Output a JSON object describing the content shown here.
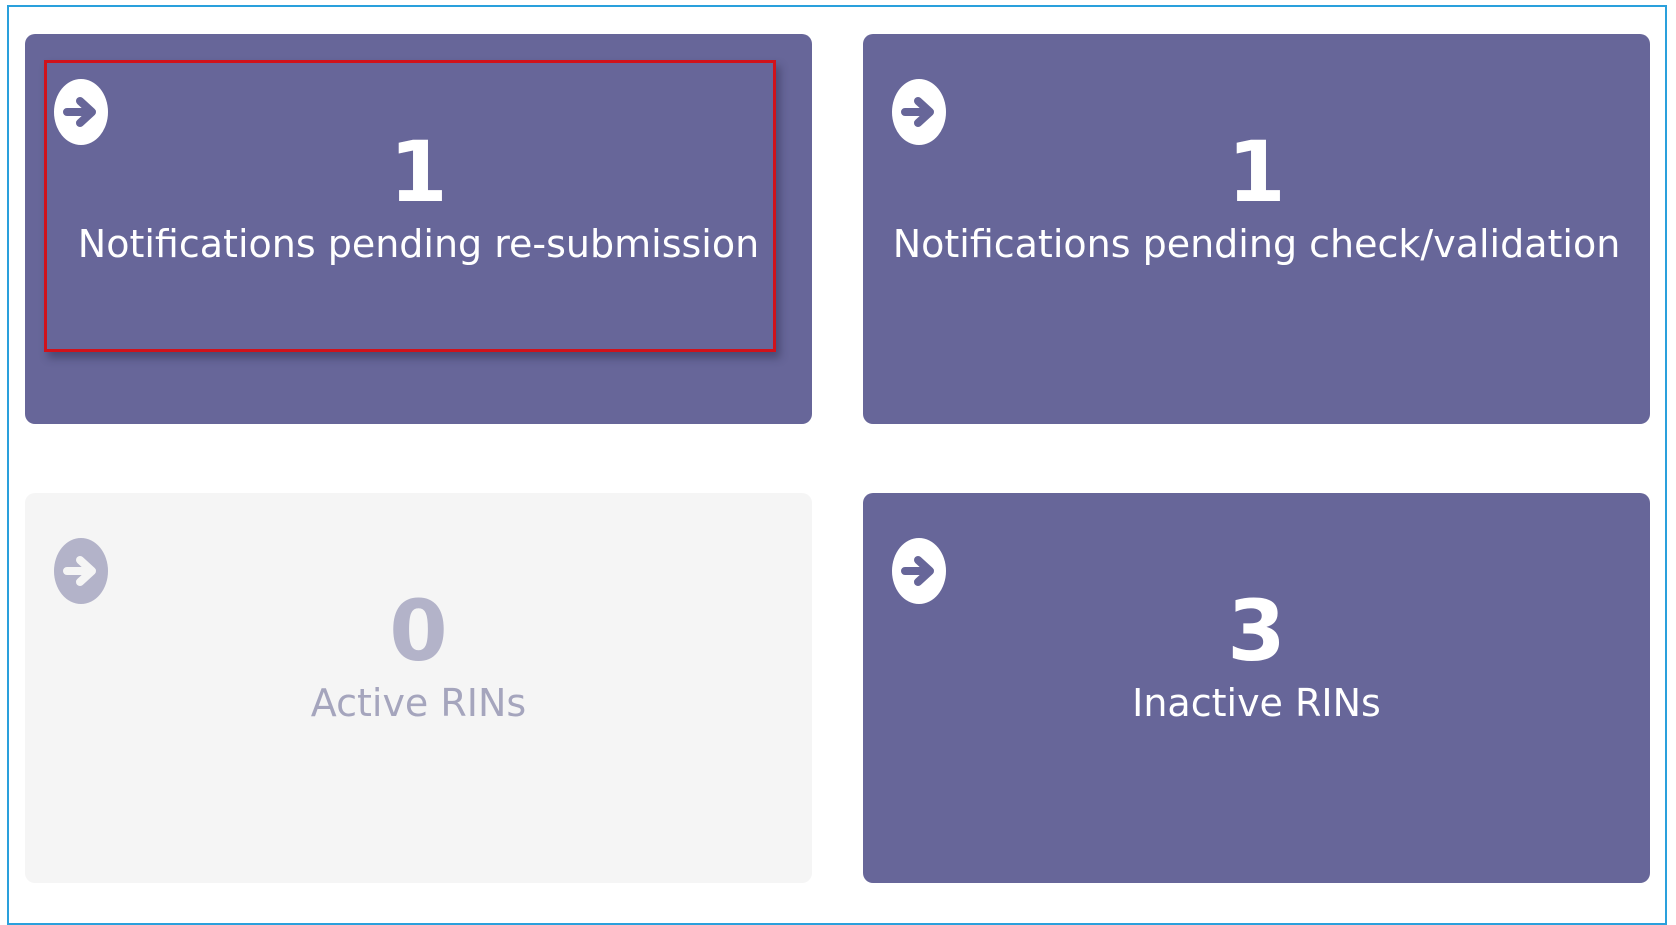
{
  "tiles": [
    {
      "count": "1",
      "label": "Notifications pending re-submission",
      "icon": "arrow-right-circle-icon",
      "state": "active"
    },
    {
      "count": "1",
      "label": "Notifications pending check/validation",
      "icon": "arrow-right-circle-icon",
      "state": "active"
    },
    {
      "count": "0",
      "label": "Active RINs",
      "icon": "arrow-right-circle-icon",
      "state": "disabled"
    },
    {
      "count": "3",
      "label": "Inactive RINs",
      "icon": "arrow-right-circle-icon",
      "state": "active"
    }
  ],
  "colors": {
    "tile_active": "#676699",
    "tile_disabled": "#f5f5f5",
    "highlight": "#d0121b",
    "frame_border": "#2aa0dc"
  }
}
